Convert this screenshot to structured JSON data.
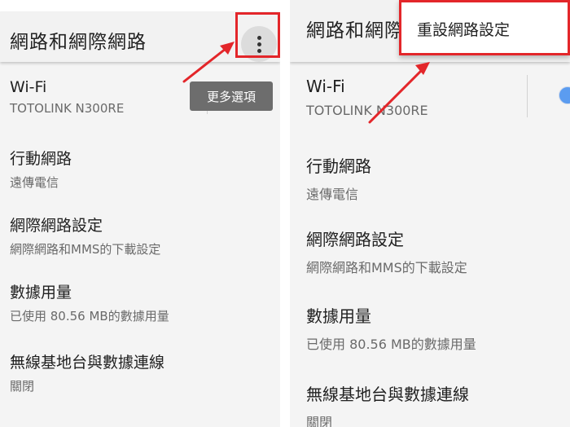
{
  "left": {
    "title": "網路和網際網路",
    "tooltip": "更多選項",
    "items": [
      {
        "title": "Wi-Fi",
        "subtitle": "TOTOLINK N300RE"
      },
      {
        "title": "行動網路",
        "subtitle": "遠傳電信"
      },
      {
        "title": "網際網路設定",
        "subtitle": "網際網路和MMS的下載設定"
      },
      {
        "title": "數據用量",
        "subtitle": "已使用 80.56 MB的數據用量"
      },
      {
        "title": "無線基地台與數據連線",
        "subtitle": "關閉"
      }
    ]
  },
  "right": {
    "title": "網路和網際",
    "menu_item": "重設網路設定",
    "items": [
      {
        "title": "Wi-Fi",
        "subtitle": "TOTOLINK N300RE"
      },
      {
        "title": "行動網路",
        "subtitle": "遠傳電信"
      },
      {
        "title": "網際網路設定",
        "subtitle": "網際網路和MMS的下載設定"
      },
      {
        "title": "數據用量",
        "subtitle": "已使用 80.56 MB的數據用量"
      },
      {
        "title": "無線基地台與數據連線",
        "subtitle": "關閉"
      }
    ]
  },
  "colors": {
    "highlight": "#e3262a",
    "toggle": "#5b9cf0"
  },
  "icons": {
    "more": "more-vertical-icon",
    "arrow": "annotation-arrow"
  }
}
